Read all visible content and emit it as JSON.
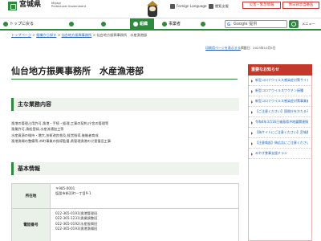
{
  "header": {
    "logo_title": "宮城県",
    "logo_sub_1": "Miyagi",
    "logo_sub_2": "Prefectural Government",
    "foreign_language": "Foreign Language",
    "reading_aid": "閲覧支援",
    "disaster_button": "災害・緊急情報",
    "facility_button": "休日救急当番医"
  },
  "nav": {
    "home": "トップに戻る",
    "items": [
      "",
      "",
      "組織",
      "事業者",
      ""
    ]
  },
  "search": {
    "logo": "G",
    "placeholder": "Google 提供"
  },
  "menu_label": "メニュー",
  "breadcrumb": {
    "crumb_1": "トップページ",
    "sep": " > ",
    "crumb_2": "組織から探す",
    "crumb_3": "仙台地方振興事務所",
    "current": "仙台地方振興事務所　水産漁港部"
  },
  "print_link": "印刷用ページを表示する",
  "update_text": "掲載日：2023年10月5日",
  "page_title": "仙台地方振興事務所　水産漁港部",
  "main_duties": {
    "heading": "主な業務内容",
    "lines": [
      "漁港の管理占用許可,漁港・手続・経理,工事の契約,庁舎の管理等",
      "漁業許可,漁船登録,水産流通加工等",
      "水産資源の維持・増大,技術改良普及,経営指導,後継者育成",
      "漁港漁場の整備等,市町事業の指導監督,県管理漁港の災害復旧工事"
    ]
  },
  "basic_info": {
    "heading": "基本情報",
    "address_label": "所在地",
    "address_lines": [
      "〒985-0001",
      "塩釜市新浜町一丁目9-1"
    ],
    "tel_label": "電話番号",
    "tel_lines": [
      "022-365-0191(漁港管理班",
      "022-365-1231(漁業調整班",
      "022-365-0192(水産振興班",
      "022-365-0193(漁港漁場班"
    ]
  },
  "sidebar": {
    "heading": "重要なお知らせ",
    "items": [
      "新型コロナウイルス感染症対策サイト",
      "新型コロナウイルスワクチン接種",
      "新型コロナウイルス感染症対策事業者支援パッケージについて",
      "【ご注意ください】国税庁をかたる不審なショートメッセージ",
      "令和4年3月16日福島県沖地震関連情報",
      "【偽サイトにご注意ください】宮城県公式ウェブサイトの偽サイト",
      "【注意喚起】偽広告にご注意ください（宮城県とは関係ありません）",
      "みやぎ食事支援チラシ"
    ]
  },
  "colors": {
    "brand_green": "#2e8b3e",
    "alert_red": "#c0392b",
    "link_blue": "#1a5fb4"
  }
}
